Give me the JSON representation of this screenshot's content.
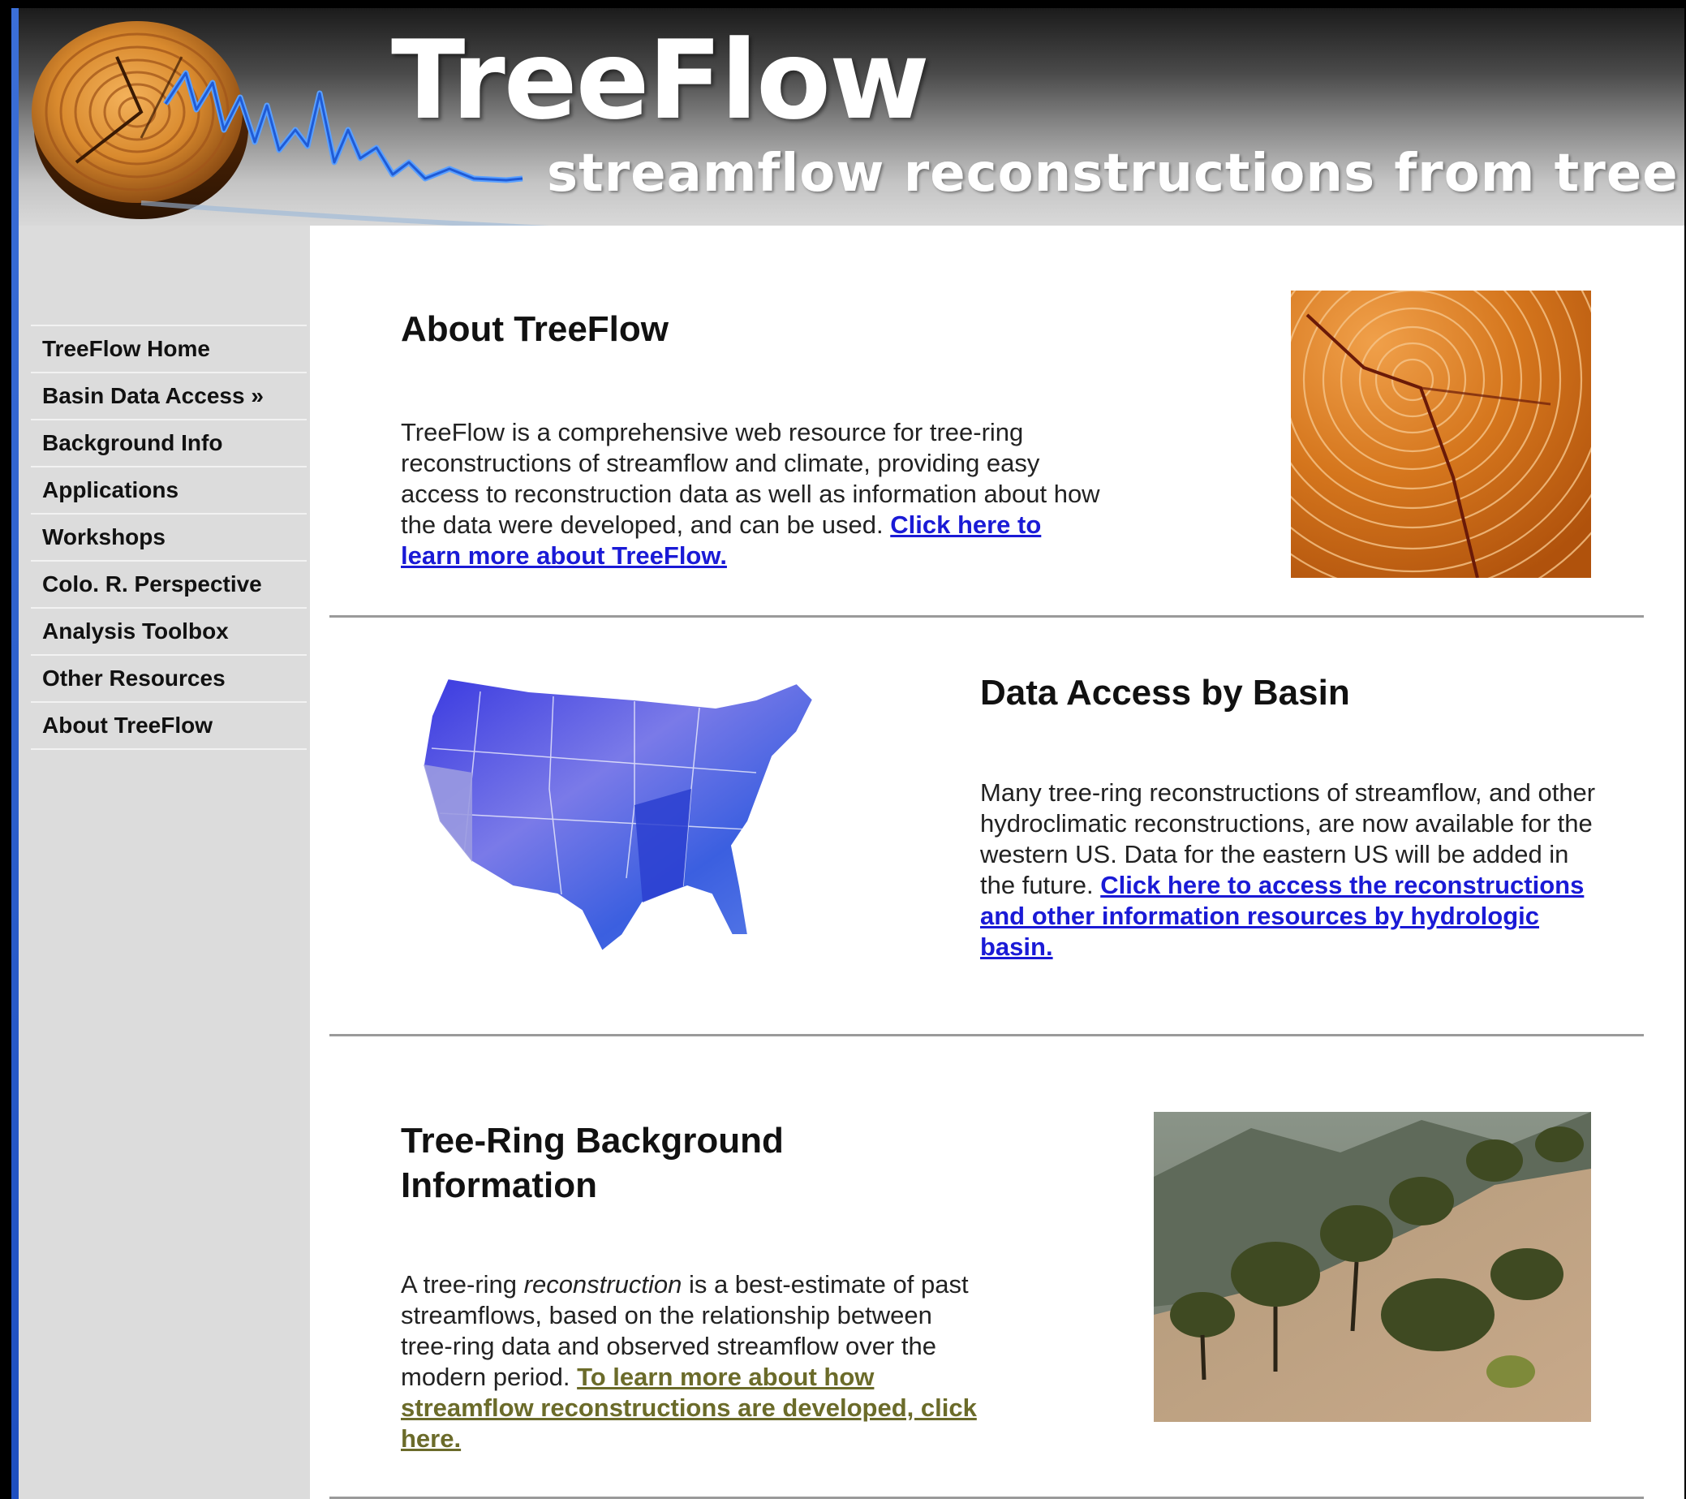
{
  "header": {
    "title": "TreeFlow",
    "tagline": "streamflow reconstructions from tree rings"
  },
  "sidebar": {
    "items": [
      {
        "label": "TreeFlow Home"
      },
      {
        "label": "Basin Data Access »"
      },
      {
        "label": "Background Info"
      },
      {
        "label": "Applications"
      },
      {
        "label": "Workshops"
      },
      {
        "label": "Colo. R. Perspective"
      },
      {
        "label": "Analysis Toolbox"
      },
      {
        "label": "Other Resources"
      },
      {
        "label": "About TreeFlow"
      }
    ]
  },
  "sections": {
    "about": {
      "title": "About TreeFlow",
      "text": "TreeFlow is a comprehensive web resource for tree-ring reconstructions of streamflow and climate, providing easy access to reconstruction data as well as information about how the data were developed, and can be used. ",
      "link": "Click here to learn more about TreeFlow."
    },
    "data_access": {
      "title": "Data Access by Basin",
      "text": "Many tree-ring reconstructions of streamflow, and other hydroclimatic reconstructions, are now available for the western US. Data for the eastern US will be added in the future. ",
      "link": "Click here to access the reconstructions and other information resources by hydrologic basin."
    },
    "background": {
      "title": "Tree-Ring Background Information",
      "text_before": "A tree-ring ",
      "text_italic": "reconstruction",
      "text_after": " is a best-estimate of past streamflows, based on the relationship between tree-ring data and observed streamflow over the modern period. ",
      "link": "To learn more about how streamflow reconstructions are developed, click here."
    }
  },
  "colors": {
    "link_blue": "#1a1ad6",
    "link_olive": "#6b6b2a",
    "sidebar_bg": "#dcdcdc",
    "left_edge": "#2a5cd0"
  }
}
